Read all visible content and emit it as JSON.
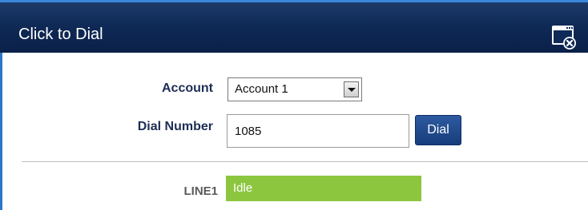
{
  "window": {
    "title": "Click to Dial"
  },
  "form": {
    "account_label": "Account",
    "account_selected": "Account 1",
    "dial_number_label": "Dial Number",
    "dial_number_value": "1085",
    "dial_button_label": "Dial"
  },
  "line": {
    "label": "LINE1",
    "status": "Idle",
    "status_color": "#8cc63f"
  },
  "icons": {
    "close": "window-close-icon",
    "select_arrow": "chevron-down-icon"
  },
  "colors": {
    "titlebar": "#0f2a56",
    "label_text": "#1d2d55",
    "button": "#1f4a8c"
  }
}
